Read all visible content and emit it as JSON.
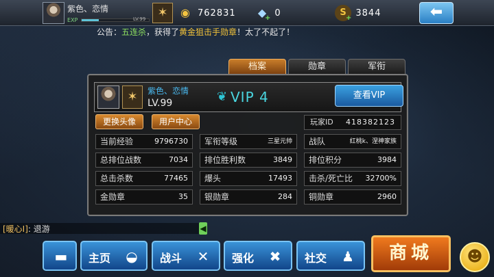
{
  "top": {
    "player_name": "紫色、恋情",
    "exp_label": "EXP",
    "exp_fraction": 0.25,
    "level_small": "LV.99",
    "gold": "762831",
    "diamonds": "0",
    "sp": "3844",
    "sp_icon_text": "S"
  },
  "announcement": {
    "prefix": "公告：",
    "player": "五连杀",
    "mid": "，获得了",
    "medal": "黄金狙击手勋章",
    "suffix": "！太了不起了！"
  },
  "tabs": [
    "档案",
    "勋章",
    "军衔"
  ],
  "profile": {
    "name": "紫色、恋情",
    "level": "LV.99",
    "vip": "VIP 4",
    "view_vip_label": "查看VIP",
    "change_avatar_label": "更换头像",
    "user_center_label": "用户中心",
    "player_id_label": "玩家ID",
    "player_id": "418382123"
  },
  "stats": [
    [
      {
        "k": "当前经验",
        "v": "9796730"
      },
      {
        "k": "军衔等级",
        "v": "三星元帅"
      },
      {
        "k": "战队",
        "v": "红桃k、涅神家族"
      }
    ],
    [
      {
        "k": "总排位战数",
        "v": "7034"
      },
      {
        "k": "排位胜利数",
        "v": "3849"
      },
      {
        "k": "排位积分",
        "v": "3984"
      }
    ],
    [
      {
        "k": "总击杀数",
        "v": "77465"
      },
      {
        "k": "爆头",
        "v": "17493"
      },
      {
        "k": "击杀/死亡比",
        "v": "32700%"
      }
    ],
    [
      {
        "k": "金勋章",
        "v": "35"
      },
      {
        "k": "银勋章",
        "v": "284"
      },
      {
        "k": "铜勋章",
        "v": "2960"
      }
    ]
  ],
  "chat": {
    "channel": "[暖心I]",
    "message": ": 退游"
  },
  "nav": {
    "home": "主页",
    "battle": "战斗",
    "upgrade": "强化",
    "social": "社交",
    "shop": "商城"
  },
  "colors": {
    "accent_blue": "#3a93d8",
    "shop_orange": "#f07a1e",
    "vip_cyan": "#4ad6e0",
    "name_blue": "#49b8ee"
  }
}
